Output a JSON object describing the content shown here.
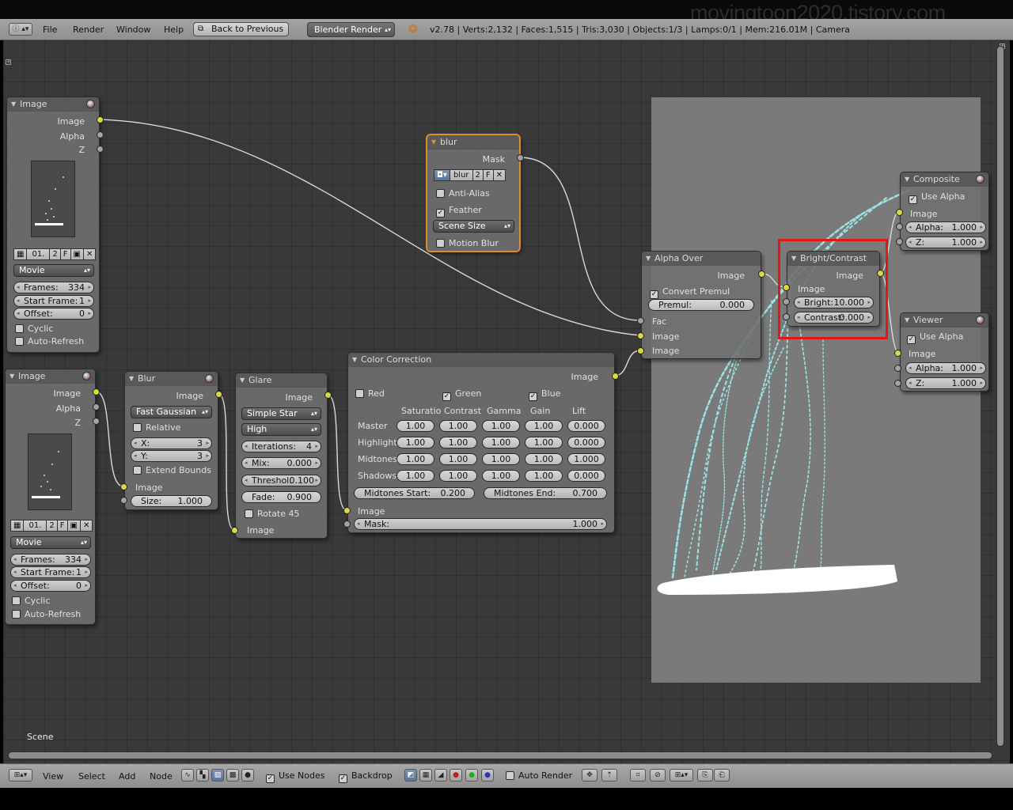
{
  "watermark": "movingtoon2020.tistory.com",
  "infobar": {
    "menus": [
      "File",
      "Render",
      "Window",
      "Help"
    ],
    "back_button": "Back to Previous",
    "engine": "Blender Render",
    "stats": "v2.78 | Verts:2,132 | Faces:1,515 | Tris:3,030 | Objects:1/3 | Lamps:0/1 | Mem:216.01M | Camera"
  },
  "nodes": {
    "image1": {
      "title": "Image",
      "outputs": [
        "Image",
        "Alpha",
        "Z"
      ],
      "file": {
        "name": "01.",
        "users": "2",
        "fake": "F"
      },
      "source": "Movie",
      "frames_label": "Frames:",
      "frames": "334",
      "start_label": "Start Frame:",
      "start": "1",
      "offset_label": "Offset:",
      "offset": "0",
      "cyclic": "Cyclic",
      "auto_refresh": "Auto-Refresh"
    },
    "image2": {
      "title": "Image",
      "outputs": [
        "Image",
        "Alpha",
        "Z"
      ],
      "file": {
        "name": "01.",
        "users": "2",
        "fake": "F"
      },
      "source": "Movie",
      "frames_label": "Frames:",
      "frames": "334",
      "start_label": "Start Frame:",
      "start": "1",
      "offset_label": "Offset:",
      "offset": "0",
      "cyclic": "Cyclic",
      "auto_refresh": "Auto-Refresh"
    },
    "mask": {
      "title": "blur",
      "output": "Mask",
      "datablock": {
        "name": "blur",
        "users": "2",
        "fake": "F"
      },
      "anti_alias": "Anti-Alias",
      "feather": "Feather",
      "size_mode": "Scene Size",
      "motion_blur": "Motion Blur"
    },
    "blur": {
      "title": "Blur",
      "output": "Image",
      "filter": "Fast Gaussian",
      "relative": "Relative",
      "x_label": "X:",
      "x": "3",
      "y_label": "Y:",
      "y": "3",
      "extend_bounds": "Extend Bounds",
      "input": "Image",
      "size_label": "Size:",
      "size": "1.000"
    },
    "glare": {
      "title": "Glare",
      "output": "Image",
      "type": "Simple Star",
      "quality": "High",
      "iterations_label": "Iterations:",
      "iterations": "4",
      "mix_label": "Mix:",
      "mix": "0.000",
      "threshold_label": "Threshol:",
      "threshold": "0.100",
      "fade_label": "Fade:",
      "fade": "0.900",
      "rotate45": "Rotate 45",
      "input": "Image"
    },
    "color_correction": {
      "title": "Color Correction",
      "output": "Image",
      "channels": {
        "red": "Red",
        "green": "Green",
        "blue": "Blue"
      },
      "columns": [
        "Saturatio",
        "Contrast",
        "Gamma",
        "Gain",
        "Lift"
      ],
      "rows": [
        {
          "label": "Master",
          "values": [
            "1.00",
            "1.00",
            "1.00",
            "1.00",
            "0.000"
          ]
        },
        {
          "label": "Highlight",
          "values": [
            "1.00",
            "1.00",
            "1.00",
            "1.00",
            "0.000"
          ]
        },
        {
          "label": "Midtones",
          "values": [
            "1.00",
            "1.00",
            "1.00",
            "1.00",
            "1.000"
          ]
        },
        {
          "label": "Shadows",
          "values": [
            "1.00",
            "1.00",
            "1.00",
            "1.00",
            "0.000"
          ]
        }
      ],
      "midtones_start_label": "Midtones Start:",
      "midtones_start": "0.200",
      "midtones_end_label": "Midtones End:",
      "midtones_end": "0.700",
      "input": "Image",
      "mask_label": "Mask:",
      "mask": "1.000"
    },
    "alpha_over": {
      "title": "Alpha Over",
      "output": "Image",
      "convert_premul": "Convert Premul",
      "premul_label": "Premul:",
      "premul": "0.000",
      "inputs": [
        "Fac",
        "Image",
        "Image"
      ]
    },
    "bright_contrast": {
      "title": "Bright/Contrast",
      "output": "Image",
      "input": "Image",
      "bright_label": "Bright:",
      "bright": "10.000",
      "contrast_label": "Contrast:",
      "contrast": "0.000"
    },
    "composite": {
      "title": "Composite",
      "use_alpha": "Use Alpha",
      "input": "Image",
      "alpha_label": "Alpha:",
      "alpha": "1.000",
      "z_label": "Z:",
      "z": "1.000"
    },
    "viewer": {
      "title": "Viewer",
      "use_alpha": "Use Alpha",
      "input": "Image",
      "alpha_label": "Alpha:",
      "alpha": "1.000",
      "z_label": "Z:",
      "z": "1.000"
    }
  },
  "scene_label": "Scene",
  "header": {
    "menus": [
      "View",
      "Select",
      "Add",
      "Node"
    ],
    "use_nodes": "Use Nodes",
    "backdrop": "Backdrop",
    "auto_render": "Auto Render"
  },
  "colors": {
    "grid_bg": "#393939",
    "node_body": "#707070",
    "socket_image": "#d8d845",
    "socket_value": "#a2a2a2",
    "highlight_box": "#e01818",
    "active_node": "#e28b2c",
    "glow_streaks": "#9fefef"
  }
}
